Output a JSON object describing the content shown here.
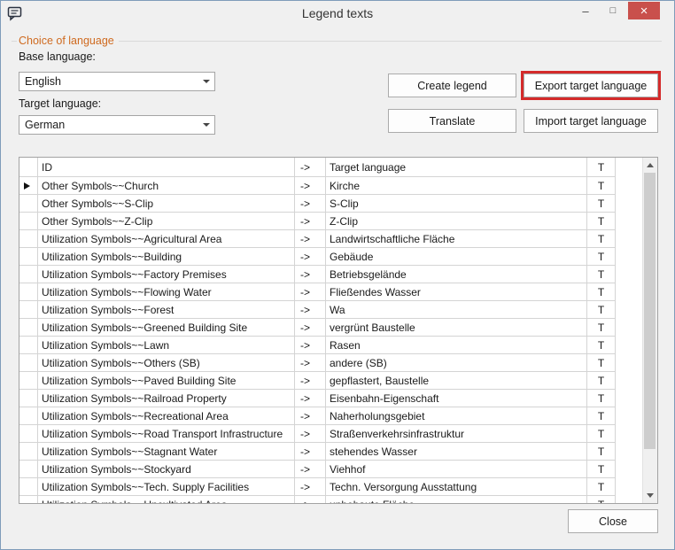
{
  "window": {
    "title": "Legend texts",
    "minimize_glyph": "–",
    "maximize_glyph": "□",
    "close_glyph": "×"
  },
  "icons": {
    "app": "speech-bubble-icon",
    "combo_arrow": "chevron-down-icon",
    "row_marker": "current-row-triangle-icon",
    "scroll_up": "scroll-up-arrow-icon",
    "scroll_down": "scroll-down-arrow-icon"
  },
  "colors": {
    "highlight_annotation": "#d42a2a",
    "group_title": "#cf6a1f",
    "close_caption_button": "#c9504c",
    "dialog_background": "#f0f0f0",
    "dialog_border": "#7f9cba"
  },
  "language_group": {
    "title": "Choice of language",
    "base_label": "Base language:",
    "base_value": "English",
    "target_label": "Target language:",
    "target_value": "German"
  },
  "actions": {
    "create_legend": "Create legend",
    "export_target": "Export target language",
    "translate": "Translate",
    "import_target": "Import target language"
  },
  "footer": {
    "close": "Close"
  },
  "table": {
    "headers": {
      "id": "ID",
      "arrow": "->",
      "target": "Target language",
      "t": "T"
    },
    "rows": [
      {
        "id": "Other Symbols~~Church",
        "arrow": "->",
        "target": "Kirche",
        "t": "T",
        "selected": true
      },
      {
        "id": "Other Symbols~~S-Clip",
        "arrow": "->",
        "target": "S-Clip",
        "t": "T"
      },
      {
        "id": "Other Symbols~~Z-Clip",
        "arrow": "->",
        "target": "Z-Clip",
        "t": "T"
      },
      {
        "id": "Utilization Symbols~~Agricultural Area",
        "arrow": "->",
        "target": "Landwirtschaftliche Fläche",
        "t": "T"
      },
      {
        "id": "Utilization Symbols~~Building",
        "arrow": "->",
        "target": "Gebäude",
        "t": "T"
      },
      {
        "id": "Utilization Symbols~~Factory Premises",
        "arrow": "->",
        "target": "Betriebsgelände",
        "t": "T"
      },
      {
        "id": "Utilization Symbols~~Flowing Water",
        "arrow": "->",
        "target": "Fließendes Wasser",
        "t": "T"
      },
      {
        "id": "Utilization Symbols~~Forest",
        "arrow": "->",
        "target": "Wa",
        "t": "T"
      },
      {
        "id": "Utilization Symbols~~Greened Building Site",
        "arrow": "->",
        "target": "vergrünt Baustelle",
        "t": "T"
      },
      {
        "id": "Utilization Symbols~~Lawn",
        "arrow": "->",
        "target": "Rasen",
        "t": "T"
      },
      {
        "id": "Utilization Symbols~~Others (SB)",
        "arrow": "->",
        "target": "andere (SB)",
        "t": "T"
      },
      {
        "id": "Utilization Symbols~~Paved Building Site",
        "arrow": "->",
        "target": "gepflastert, Baustelle",
        "t": "T"
      },
      {
        "id": "Utilization Symbols~~Railroad Property",
        "arrow": "->",
        "target": "Eisenbahn-Eigenschaft",
        "t": "T"
      },
      {
        "id": "Utilization Symbols~~Recreational Area",
        "arrow": "->",
        "target": "Naherholungsgebiet",
        "t": "T"
      },
      {
        "id": "Utilization Symbols~~Road Transport Infrastructure",
        "arrow": "->",
        "target": "Straßenverkehrsinfrastruktur",
        "t": "T"
      },
      {
        "id": "Utilization Symbols~~Stagnant Water",
        "arrow": "->",
        "target": "stehendes Wasser",
        "t": "T"
      },
      {
        "id": "Utilization Symbols~~Stockyard",
        "arrow": "->",
        "target": "Viehhof",
        "t": "T"
      },
      {
        "id": "Utilization Symbols~~Tech. Supply Facilities",
        "arrow": "->",
        "target": "Techn. Versorgung Ausstattung",
        "t": "T"
      },
      {
        "id": "Utilization Symbols~~Uncultivated Area",
        "arrow": "->",
        "target": "unbebaute Fläche",
        "t": "T"
      }
    ]
  }
}
